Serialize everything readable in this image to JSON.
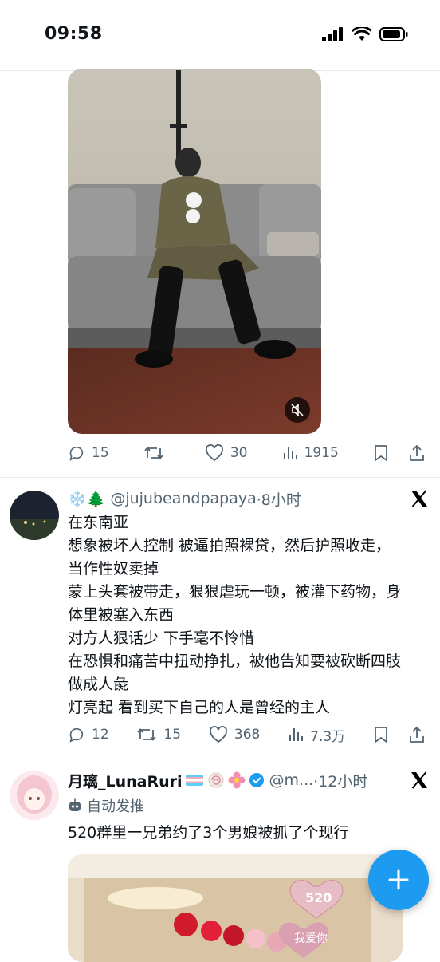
{
  "status_bar": {
    "time": "09:58"
  },
  "tweet1": {
    "stats": {
      "replies": "15",
      "retweets": "",
      "likes": "30",
      "views": "1915"
    }
  },
  "tweet2": {
    "name_emojis": "❄️🌲",
    "handle": "@jujubeandpapaya",
    "time": "·8小时",
    "lines": [
      "在东南亚",
      "想象被坏人控制 被逼拍照裸贷，然后护照收走，",
      "当作性奴卖掉",
      "蒙上头套被带走，狠狠虐玩一顿，被灌下药物，身",
      "体里被塞入东西",
      "对方人狠话少 下手毫不怜惜",
      "在恐惧和痛苦中扭动挣扎，被他告知要被砍断四肢",
      "做成人彘",
      "灯亮起 看到买下自己的人是曾经的主人"
    ],
    "stats": {
      "replies": "12",
      "retweets": "15",
      "likes": "368",
      "views": "7.3万"
    }
  },
  "tweet3": {
    "name": "月璃_LunaRuri",
    "handle": "@m...",
    "time": "·12小时",
    "bot_label": "自动发推",
    "text": "520群里一兄弟约了3个男娘被抓了个现行",
    "image_text": {
      "balloon_number": "520",
      "balloon_text": "我爱你"
    }
  },
  "colors": {
    "accent": "#1d9bf0",
    "muted": "#536471",
    "text": "#0f1419"
  }
}
